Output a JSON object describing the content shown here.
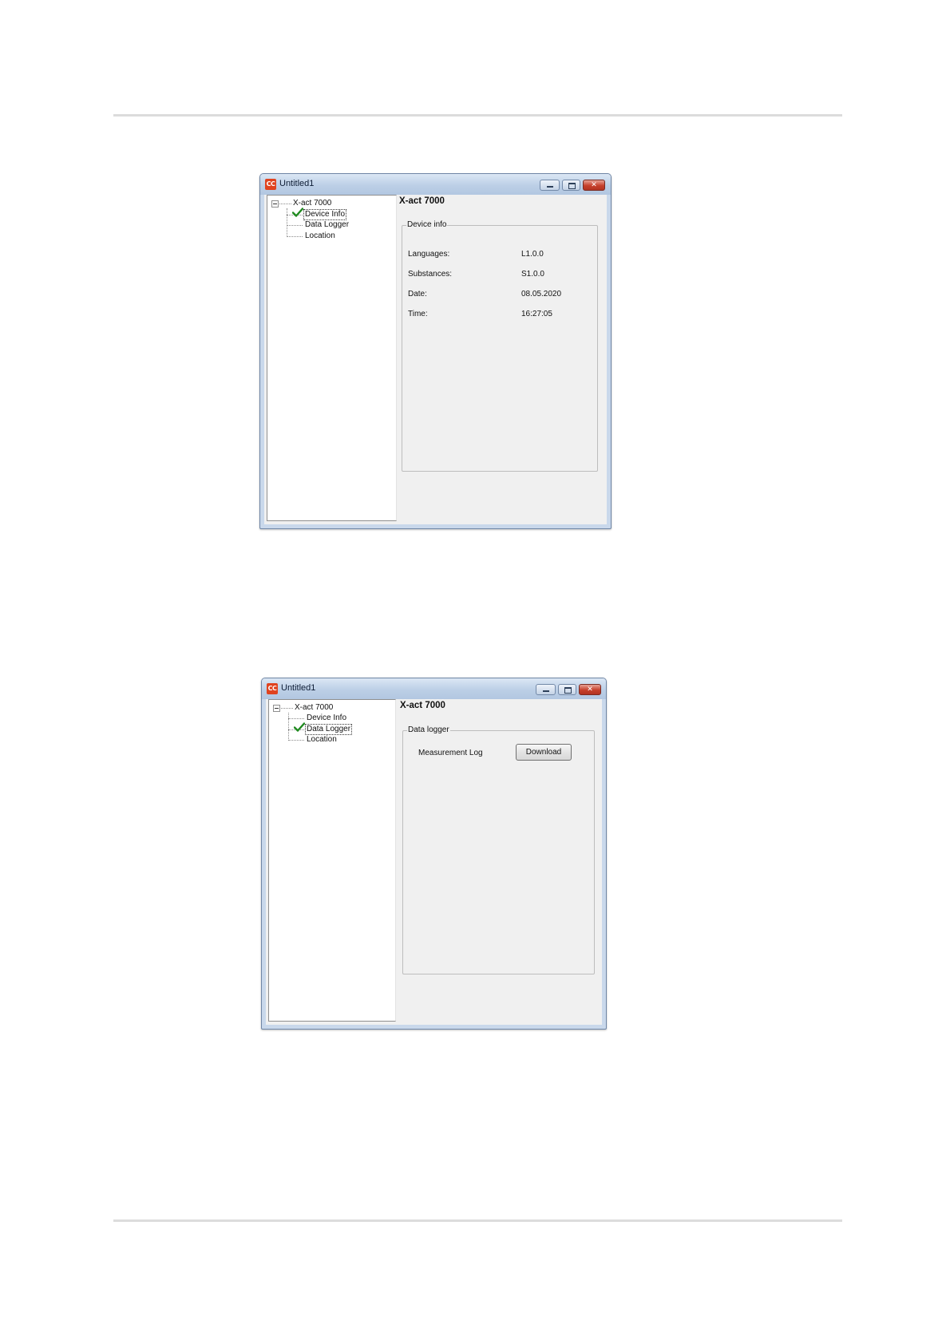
{
  "window1": {
    "title": "Untitled1",
    "app_icon": "CC",
    "tree": {
      "root": "X-act 7000",
      "items": [
        "Device Info",
        "Data Logger",
        "Location"
      ],
      "selected": "Device Info"
    },
    "panel_title": "X-act 7000",
    "group_title": "Device info",
    "rows": [
      {
        "label": "Languages:",
        "value": "L1.0.0"
      },
      {
        "label": "Substances:",
        "value": "S1.0.0"
      },
      {
        "label": "Date:",
        "value": "08.05.2020"
      },
      {
        "label": "Time:",
        "value": "16:27:05"
      }
    ]
  },
  "window2": {
    "title": "Untitled1",
    "app_icon": "CC",
    "tree": {
      "root": "X-act 7000",
      "items": [
        "Device Info",
        "Data Logger",
        "Location"
      ],
      "selected": "Data Logger"
    },
    "panel_title": "X-act 7000",
    "group_title": "Data logger",
    "log_label": "Measurement Log",
    "download_label": "Download"
  },
  "icons": {
    "app": "app-icon",
    "check": "checkmark-icon",
    "expander": "tree-collapse-icon",
    "minimize": "minimize-icon",
    "maximize": "maximize-icon",
    "close": "close-icon"
  },
  "colors": {
    "check": "#1f8a1f",
    "close_button": "#c6402c",
    "app_icon": "#e0431f"
  }
}
